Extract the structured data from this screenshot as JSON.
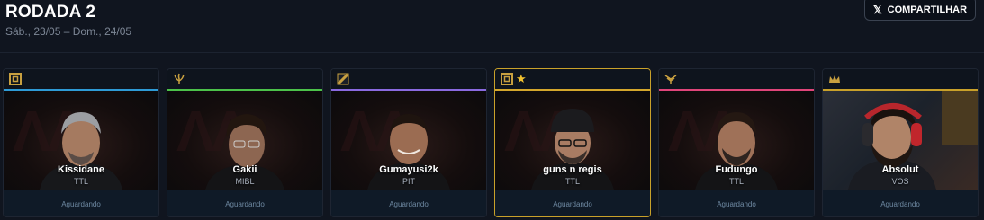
{
  "header": {
    "title": "RODADA 2",
    "subtitle": "Sáb., 23/05 – Dom., 24/05",
    "share_label": "COMPARTILHAR",
    "share_icon": "x-logo-icon"
  },
  "colors": {
    "background": "#10151f",
    "highlight_border": "#c9a12a",
    "status_text": "#6f8aa3"
  },
  "cards": [
    {
      "name": "Kissidane",
      "team": "TTL",
      "status": "Aguardando",
      "accent": "#2e9bd6",
      "icon": "square-frame-icon",
      "star": false
    },
    {
      "name": "Gakii",
      "team": "MIBL",
      "status": "Aguardando",
      "accent": "#4cc24a",
      "icon": "leaf-icon",
      "star": false
    },
    {
      "name": "Gumayusi2k",
      "team": "PIT",
      "status": "Aguardando",
      "accent": "#8a6ae0",
      "icon": "diagonal-slash-icon",
      "star": false
    },
    {
      "name": "guns n regis",
      "team": "TTL",
      "status": "Aguardando",
      "accent": "#d4a72c",
      "icon": "square-frame-icon",
      "star": true
    },
    {
      "name": "Fudungo",
      "team": "TTL",
      "status": "Aguardando",
      "accent": "#e0457a",
      "icon": "wing-icon",
      "star": false
    },
    {
      "name": "Absolut",
      "team": "VOS",
      "status": "Aguardando",
      "accent": "#c9a12a",
      "icon": "crown-icon",
      "star": false
    }
  ]
}
